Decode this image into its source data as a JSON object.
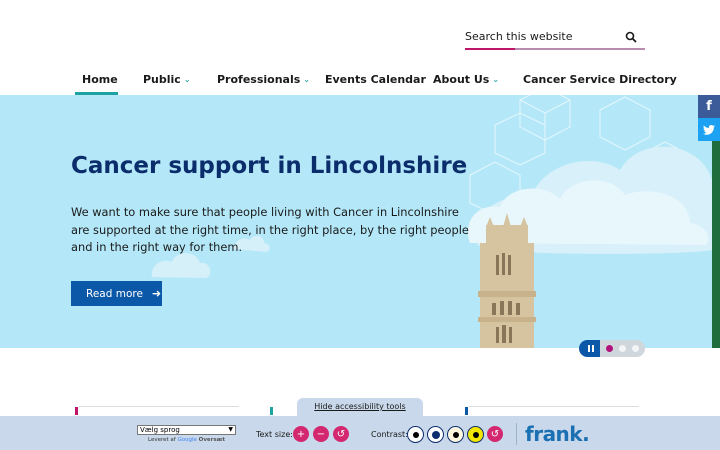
{
  "search": {
    "placeholder": "Search this website"
  },
  "nav": {
    "items": [
      {
        "label": "Home"
      },
      {
        "label": "Public"
      },
      {
        "label": "Professionals"
      },
      {
        "label": "Events Calendar"
      },
      {
        "label": "About Us"
      },
      {
        "label": "Cancer Service Directory"
      }
    ]
  },
  "hero": {
    "title": "Cancer support in Lincolnshire",
    "text": "We want to make sure that people living with Cancer in Lincolnshire are supported at the right time, in the right place, by the right people and in the right way for them.",
    "button_label": "Read more",
    "slides_total": 3,
    "slide_active": 1
  },
  "social": {
    "facebook": "f",
    "twitter": "t"
  },
  "accessibility": {
    "hide_label": "Hide accessibility tools",
    "language_select": "Vælg sprog",
    "powered_prefix": "Leveret af",
    "powered_brand": "Google",
    "powered_suffix": "Oversæt",
    "text_size_label": "Text size:",
    "contrast_label": "Contrast:",
    "logo": "frank."
  },
  "colors": {
    "brand_navy": "#0c2d6b",
    "accent_teal": "#1ea3a3",
    "accent_pink": "#d3286f",
    "hero_bg": "#b4e8f8",
    "button_blue": "#0b57a8"
  }
}
